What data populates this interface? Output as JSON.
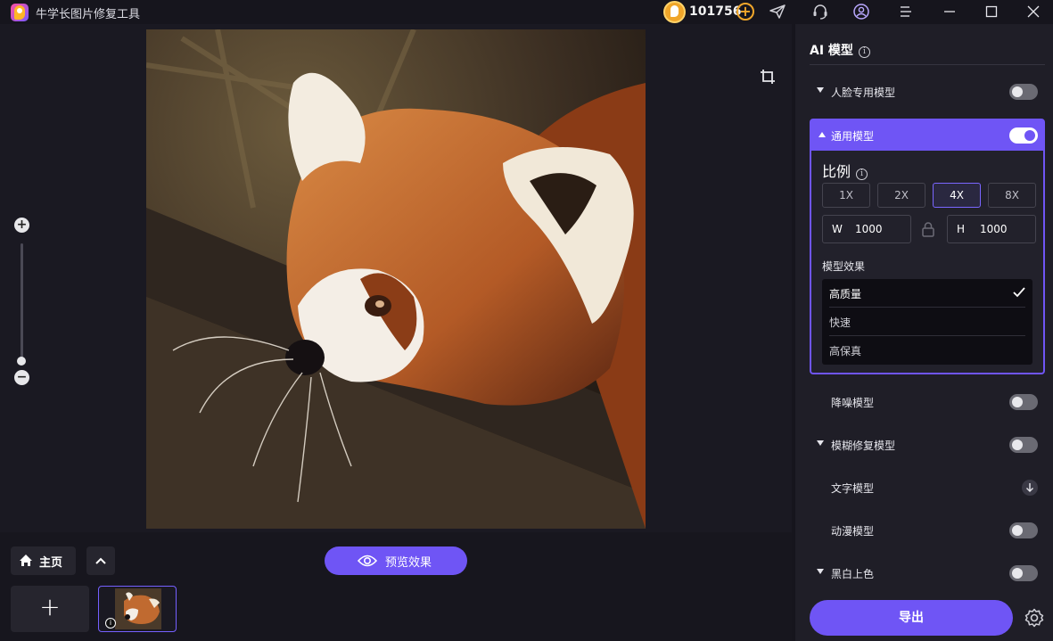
{
  "app": {
    "title": "牛学长图片修复工具"
  },
  "credits": {
    "count": "101756",
    "plus": "+"
  },
  "colors": {
    "accent": "#6f55f5",
    "coin": "#f0a62a",
    "panel": "#1f1e27"
  },
  "icons": [
    "send-icon",
    "headset-icon",
    "user-icon",
    "menu-icon",
    "minimize-icon",
    "maximize-icon",
    "close-icon",
    "crop-icon",
    "zoom-in-icon",
    "zoom-out-icon",
    "home-icon",
    "chevron-up-icon",
    "eye-icon",
    "plus-icon",
    "info-icon",
    "lock-icon",
    "check-icon",
    "download-icon",
    "gear-icon"
  ],
  "zoom": {
    "plus": "+",
    "minus": "−",
    "level_fraction": 0.0
  },
  "bottom": {
    "home_label": "主页",
    "preview_label": "预览效果",
    "add_label": "+"
  },
  "panel": {
    "title": "AI 模型",
    "info": "i",
    "models": {
      "face": {
        "label": "人脸专用模型",
        "enabled": false
      },
      "general": {
        "label": "通用模型",
        "enabled": true
      },
      "denoise": {
        "label": "降噪模型",
        "enabled": false
      },
      "deblur": {
        "label": "模糊修复模型",
        "enabled": false
      },
      "text": {
        "label": "文字模型"
      },
      "anime": {
        "label": "动漫模型",
        "enabled": false
      },
      "colorize": {
        "label": "黑白上色",
        "enabled": false
      }
    },
    "ratio": {
      "title": "比例",
      "options": [
        "1X",
        "2X",
        "4X",
        "8X"
      ],
      "selected": "4X",
      "width_key": "W",
      "width": "1000",
      "height_key": "H",
      "height": "1000"
    },
    "effect": {
      "title": "模型效果",
      "options": [
        "高质量",
        "快速",
        "高保真"
      ],
      "selected": "高质量"
    },
    "export_label": "导出"
  }
}
